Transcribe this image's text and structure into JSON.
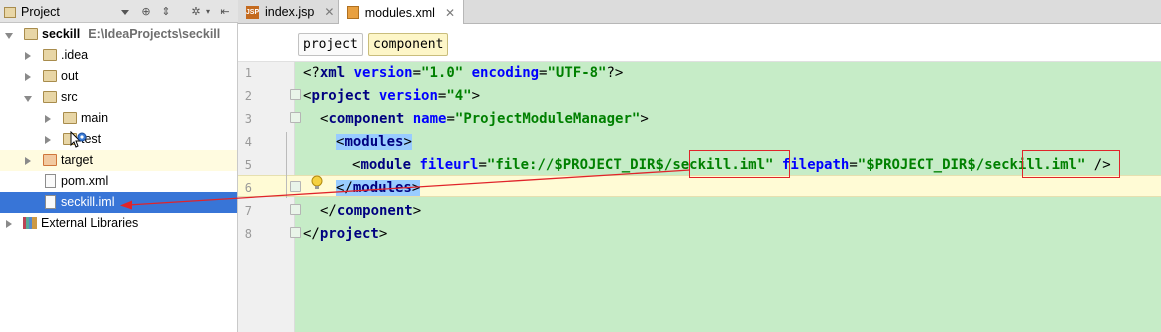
{
  "project_panel": {
    "title": "Project",
    "tree": [
      {
        "label": "seckill",
        "hint": "E:\\IdeaProjects\\seckill"
      },
      {
        "label": ".idea"
      },
      {
        "label": "out"
      },
      {
        "label": "src"
      },
      {
        "label": "main"
      },
      {
        "label": "test"
      },
      {
        "label": "target"
      },
      {
        "label": "pom.xml"
      },
      {
        "label": "seckill.iml"
      },
      {
        "label": "External Libraries"
      }
    ]
  },
  "tabs": [
    {
      "label": "index.jsp",
      "icon": "JSP"
    },
    {
      "label": "modules.xml"
    }
  ],
  "breadcrumb": [
    "project",
    "component"
  ],
  "line_numbers": [
    "1",
    "2",
    "3",
    "4",
    "5",
    "6",
    "7",
    "8"
  ],
  "code": {
    "l1": {
      "a": "<?",
      "b": "xml",
      "c": " version",
      "d": "=",
      "e": "\"1.0\"",
      "f": " encoding",
      "g": "=",
      "h": "\"UTF-8\"",
      "i": "?>"
    },
    "l2": {
      "a": "<",
      "b": "project",
      "c": " version",
      "d": "=",
      "e": "\"4\"",
      "f": ">"
    },
    "l3": {
      "a": "<",
      "b": "component",
      "c": " name",
      "d": "=",
      "e": "\"ProjectModuleManager\"",
      "f": ">"
    },
    "l4": {
      "a": "<",
      "b": "modules",
      "c": ">"
    },
    "l5": {
      "a": "<",
      "b": "module",
      "c": " fileurl",
      "d": "=",
      "e": "\"file://$PROJECT_DIR$/",
      "f": "seckill.iml",
      "g": "\"",
      "h": " filepath",
      "i": "=",
      "j": "\"$PROJECT_DIR$/",
      "k": "seckill.iml",
      "l": "\"",
      "m": " />"
    },
    "l6": {
      "a": "</",
      "b": "modules",
      "c": ">"
    },
    "l7": {
      "a": "</",
      "b": "component",
      "c": ">"
    },
    "l8": {
      "a": "</",
      "b": "project",
      "c": ">"
    }
  },
  "colors": {
    "selection": "#3875d7",
    "code_bg": "#c6ecc7",
    "annotation": "#e0242a"
  }
}
